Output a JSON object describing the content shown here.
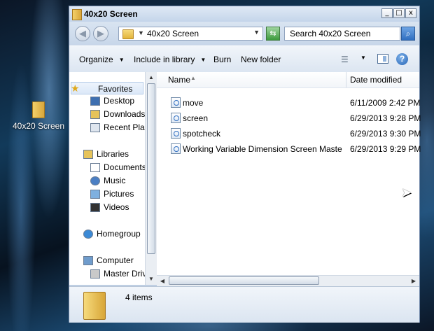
{
  "desktop": {
    "icon_label": "40x20 Screen"
  },
  "window": {
    "title": "40x20 Screen",
    "controls": {
      "minimize": "_",
      "maximize": "□",
      "close": "x"
    }
  },
  "address_bar": {
    "back": "◀",
    "forward": "▶",
    "path": "40x20 Screen",
    "search_placeholder": "Search 40x20 Screen"
  },
  "command_bar": {
    "organize": "Organize",
    "include_in_library": "Include in library",
    "burn": "Burn",
    "new_folder": "New folder",
    "help": "?"
  },
  "nav_pane": {
    "favorites": "Favorites",
    "desktop": "Desktop",
    "downloads": "Downloads",
    "recent_places": "Recent Plac",
    "libraries": "Libraries",
    "documents": "Documents",
    "music": "Music",
    "pictures": "Pictures",
    "videos": "Videos",
    "homegroup": "Homegroup",
    "computer": "Computer",
    "master_drive": "Master Drive"
  },
  "columns": {
    "name": "Name",
    "date_modified": "Date modified"
  },
  "files": [
    {
      "name": "move",
      "date": "6/11/2009 2:42 PM"
    },
    {
      "name": "screen",
      "date": "6/29/2013 9:28 PM"
    },
    {
      "name": "spotcheck",
      "date": "6/29/2013 9:30 PM"
    },
    {
      "name": "Working Variable Dimension Screen Master C...",
      "date": "6/29/2013 9:29 PM"
    }
  ],
  "details_pane": {
    "item_count": "4 items"
  }
}
